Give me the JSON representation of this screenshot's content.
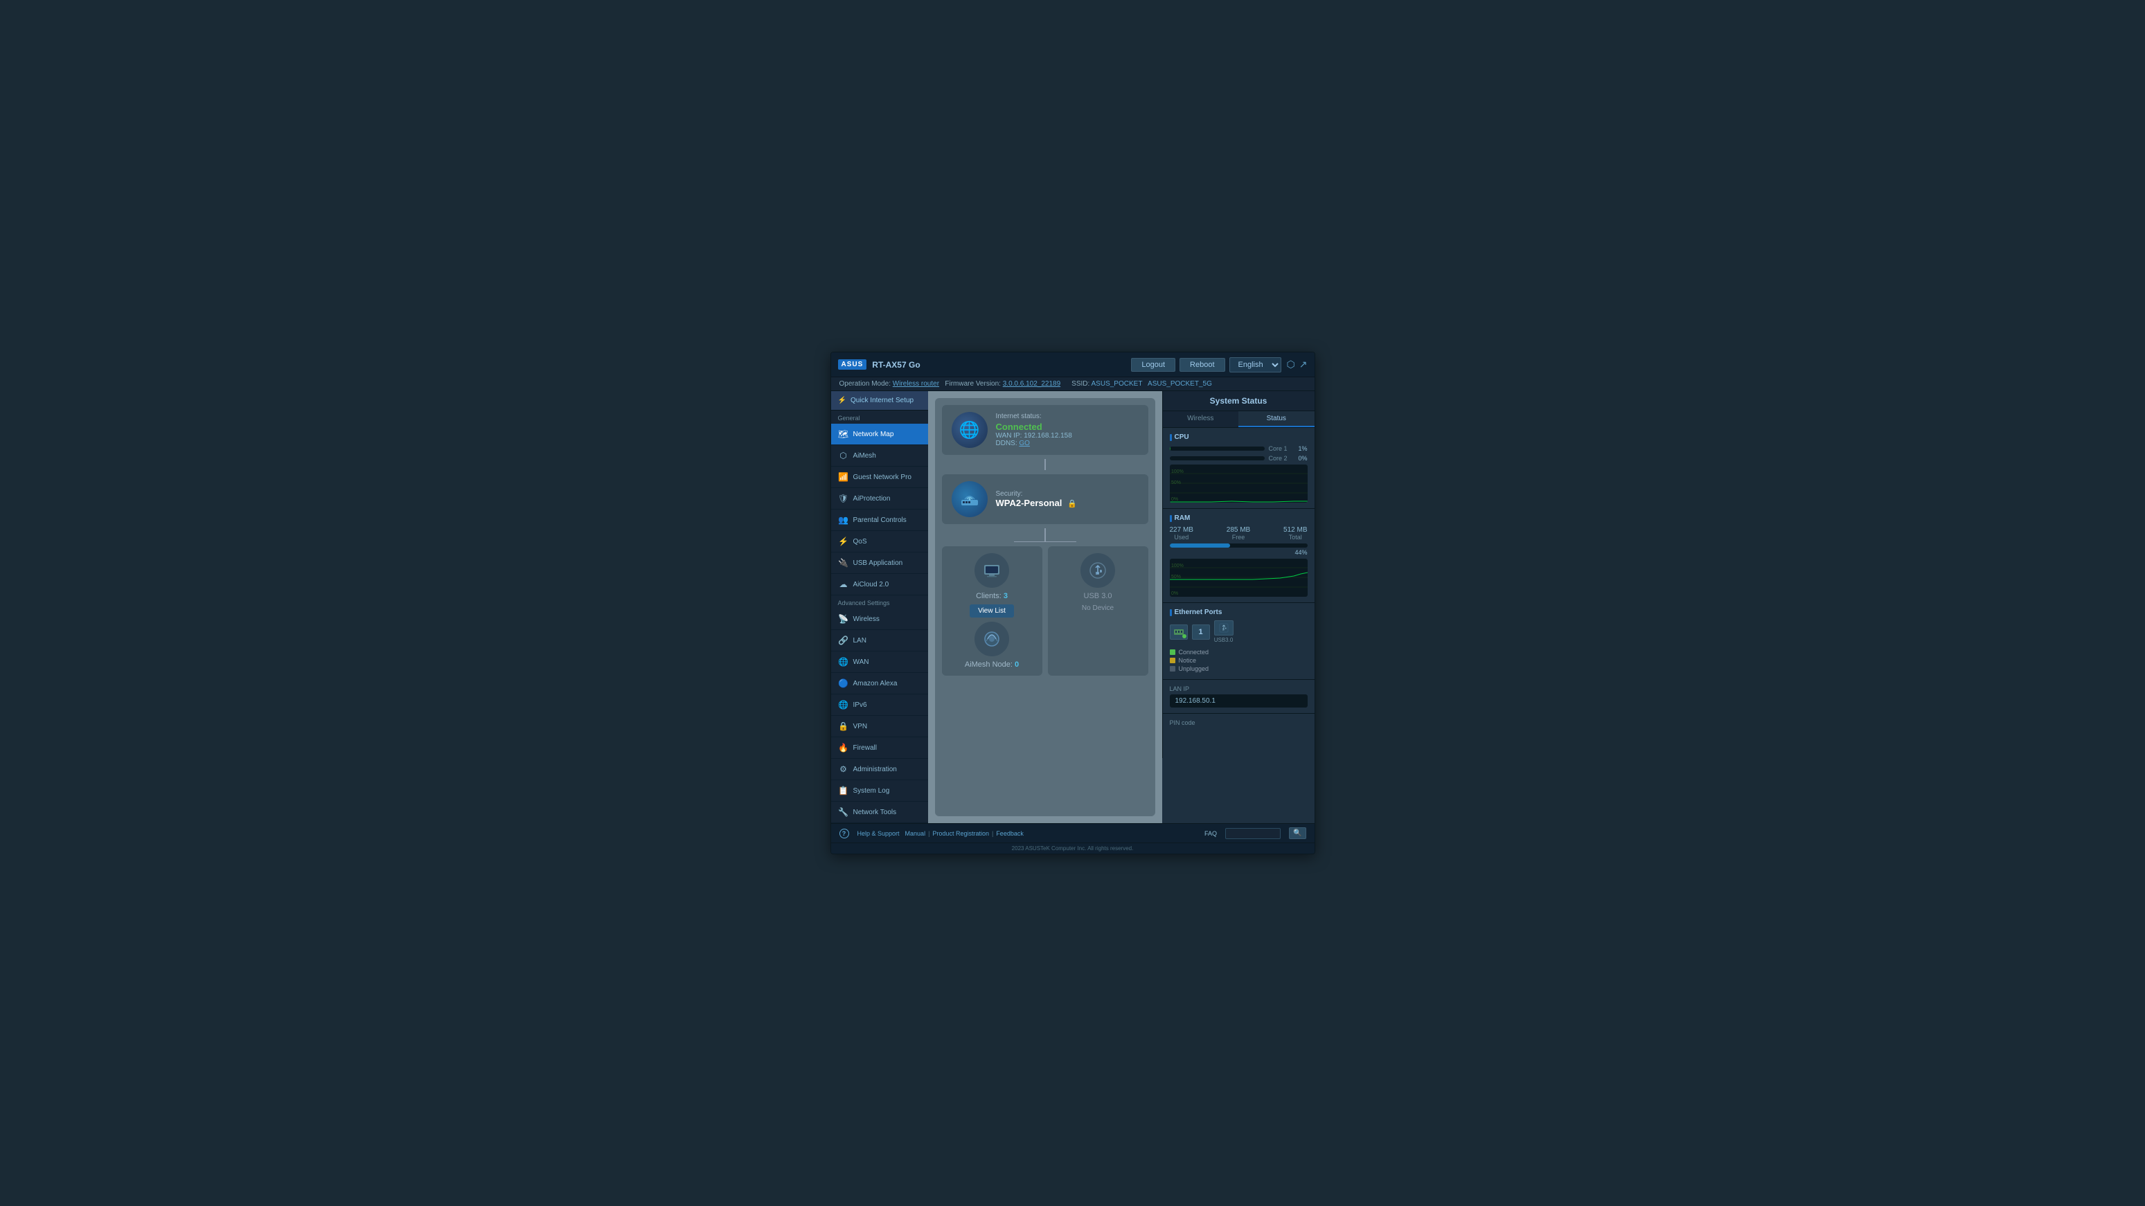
{
  "app": {
    "brand": "ASUS",
    "model": "RT-AX57 Go",
    "logout_label": "Logout",
    "reboot_label": "Reboot",
    "language": "English"
  },
  "statusbar": {
    "operation_mode_label": "Operation Mode:",
    "operation_mode_value": "Wireless router",
    "firmware_label": "Firmware Version:",
    "firmware_value": "3.0.0.6.102_22189",
    "ssid_label": "SSID:",
    "ssid1": "ASUS_POCKET",
    "ssid2": "ASUS_POCKET_5G"
  },
  "sidebar": {
    "quick_setup_label": "Quick Internet Setup",
    "general_label": "General",
    "advanced_label": "Advanced Settings",
    "items_general": [
      {
        "id": "network-map",
        "label": "Network Map",
        "icon": "🗺"
      },
      {
        "id": "aimesh",
        "label": "AiMesh",
        "icon": "⬡"
      },
      {
        "id": "guest-network",
        "label": "Guest Network Pro",
        "icon": "📶"
      },
      {
        "id": "aiprotection",
        "label": "AiProtection",
        "icon": "🛡"
      },
      {
        "id": "parental-controls",
        "label": "Parental Controls",
        "icon": "👥"
      },
      {
        "id": "qos",
        "label": "QoS",
        "icon": "⚡"
      },
      {
        "id": "usb-application",
        "label": "USB Application",
        "icon": "🔌"
      },
      {
        "id": "aicloud",
        "label": "AiCloud 2.0",
        "icon": "☁"
      }
    ],
    "items_advanced": [
      {
        "id": "wireless",
        "label": "Wireless",
        "icon": "📡"
      },
      {
        "id": "lan",
        "label": "LAN",
        "icon": "🔗"
      },
      {
        "id": "wan",
        "label": "WAN",
        "icon": "🌐"
      },
      {
        "id": "amazon-alexa",
        "label": "Amazon Alexa",
        "icon": "🔵"
      },
      {
        "id": "ipv6",
        "label": "IPv6",
        "icon": "🌐"
      },
      {
        "id": "vpn",
        "label": "VPN",
        "icon": "🔒"
      },
      {
        "id": "firewall",
        "label": "Firewall",
        "icon": "🔥"
      },
      {
        "id": "administration",
        "label": "Administration",
        "icon": "⚙"
      },
      {
        "id": "system-log",
        "label": "System Log",
        "icon": "📋"
      },
      {
        "id": "network-tools",
        "label": "Network Tools",
        "icon": "🔧"
      }
    ]
  },
  "network_map": {
    "internet": {
      "label": "Internet status:",
      "status": "Connected",
      "wan_ip_label": "WAN IP:",
      "wan_ip": "192.168.12.158",
      "ddns_label": "DDNS:",
      "ddns_link": "GO"
    },
    "router": {
      "security_label": "Security:",
      "security_value": "WPA2-Personal"
    },
    "clients": {
      "label": "Clients:",
      "count": "3",
      "view_list_label": "View List"
    },
    "usb": {
      "label": "USB 3.0",
      "status": "No Device"
    },
    "aimesh": {
      "label": "AiMesh Node:",
      "count": "0"
    }
  },
  "system_status": {
    "title": "System Status",
    "tabs": [
      {
        "id": "wireless",
        "label": "Wireless"
      },
      {
        "id": "status",
        "label": "Status"
      }
    ],
    "active_tab": "status",
    "cpu": {
      "title": "CPU",
      "core1_label": "Core 1",
      "core1_pct": "1%",
      "core1_val": 1,
      "core2_label": "Core 2",
      "core2_pct": "0%",
      "core2_val": 0
    },
    "ram": {
      "title": "RAM",
      "used_label": "Used",
      "used_val": "227 MB",
      "free_label": "Free",
      "free_val": "285 MB",
      "total_label": "Total",
      "total_val": "512 MB",
      "pct": "44%",
      "pct_val": 44
    },
    "ethernet": {
      "title": "Ethernet Ports",
      "usb_label": "USB3.0",
      "legend_connected": "Connected",
      "legend_notice": "Notice",
      "legend_unplugged": "Unplugged"
    },
    "lan_ip": {
      "label": "LAN IP",
      "value": "192.168.50.1"
    },
    "pin_code": {
      "label": "PIN code"
    }
  },
  "footer": {
    "help_icon": "?",
    "help_label": "Help & Support",
    "manual_label": "Manual",
    "product_reg_label": "Product Registration",
    "feedback_label": "Feedback",
    "faq_label": "FAQ",
    "search_placeholder": ""
  },
  "copyright": "2023 ASUSTeK Computer Inc. All rights reserved."
}
